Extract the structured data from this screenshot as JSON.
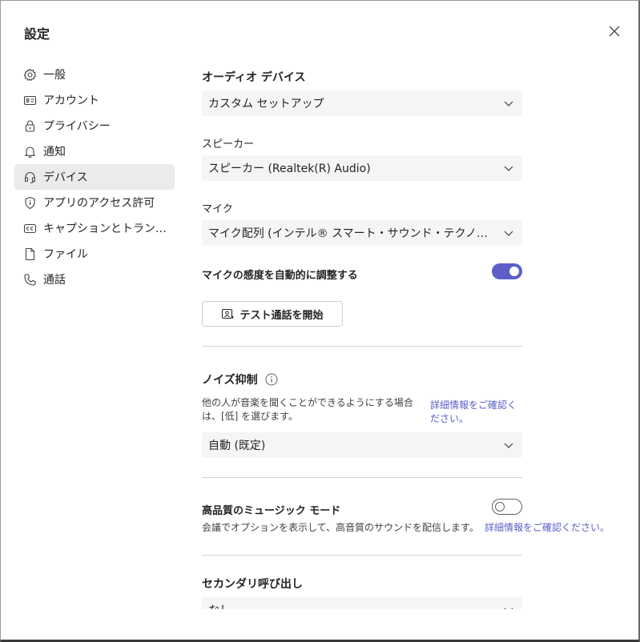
{
  "title": "設定",
  "nav": [
    {
      "label": "一般",
      "icon": "gear-icon"
    },
    {
      "label": "アカウント",
      "icon": "id-card-icon"
    },
    {
      "label": "プライバシー",
      "icon": "lock-icon"
    },
    {
      "label": "通知",
      "icon": "bell-icon"
    },
    {
      "label": "デバイス",
      "icon": "headset-icon",
      "active": true
    },
    {
      "label": "アプリのアクセス許可",
      "icon": "shield-icon"
    },
    {
      "label": "キャプションとトランスクリプト",
      "icon": "cc-icon"
    },
    {
      "label": "ファイル",
      "icon": "file-icon"
    },
    {
      "label": "通話",
      "icon": "phone-icon"
    }
  ],
  "audio": {
    "heading": "オーディオ デバイス",
    "device_value": "カスタム セットアップ",
    "speaker_label": "スピーカー",
    "speaker_value": "スピーカー (Realtek(R) Audio)",
    "mic_label": "マイク",
    "mic_value": "マイク配列 (インテル® スマート・サウンド・テクノロジー)",
    "auto_adjust_label": "マイクの感度を自動的に調整する",
    "auto_adjust_on": true,
    "test_call_label": "テスト通話を開始"
  },
  "noise": {
    "heading": "ノイズ抑制",
    "desc": "他の人が音楽を聞くことができるようにする場合は、[低] を選びます。",
    "link": "詳細情報をご確認ください。",
    "value": "自動 (既定)"
  },
  "music": {
    "heading": "高品質のミュージック モード",
    "on": false,
    "desc": "会議でオプションを表示して、高音質のサウンドを配信します。",
    "link": "詳細情報をご確認ください。"
  },
  "secondary": {
    "heading": "セカンダリ呼び出し",
    "value": "なし"
  },
  "colors": {
    "accent": "#5b5fc7",
    "select_bg": "#f5f5f5",
    "active_nav": "#ebebeb"
  }
}
